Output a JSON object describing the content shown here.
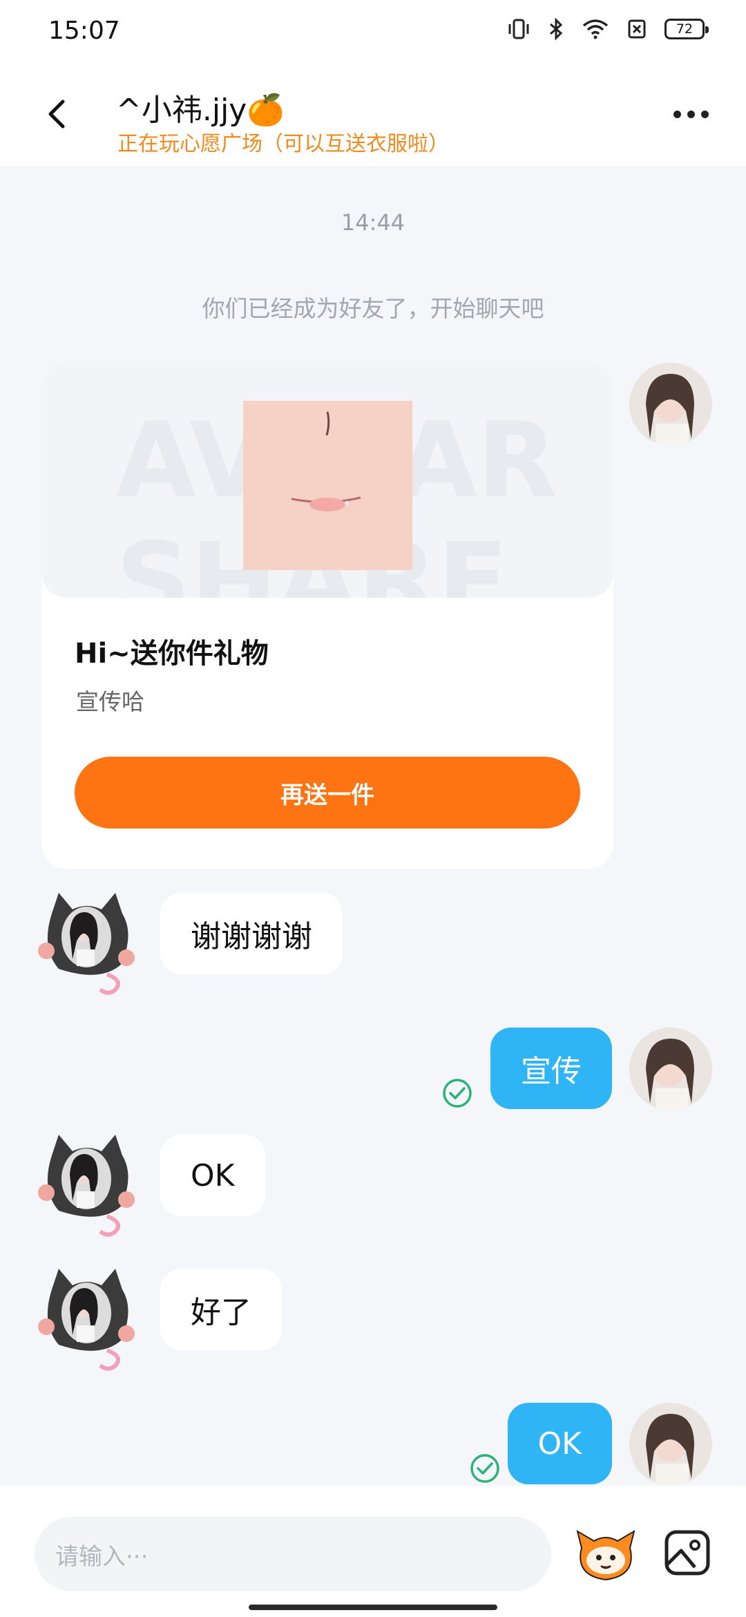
{
  "status_bar": {
    "time": "15:07",
    "battery": "72",
    "icons": [
      "vibrate-icon",
      "bluetooth-icon",
      "wifi-icon",
      "sim-off-icon",
      "battery-icon"
    ]
  },
  "header": {
    "title": "^小祎.jjy🍊",
    "subtitle": "正在玩心愿广场（可以互送衣服啦）",
    "back_icon": "back-arrow-icon",
    "more_icon": "more-dots-icon"
  },
  "chat": {
    "time_separator": "14:44",
    "system_note": "你们已经成为好友了，开始聊天吧",
    "gift_card": {
      "watermark": "AVATAR SHARE",
      "title": "Hi~送你件礼物",
      "subtitle": "宣传哈",
      "button_label": "再送一件"
    },
    "messages": [
      {
        "side": "in",
        "text": "谢谢谢谢"
      },
      {
        "side": "out",
        "text": "宣传",
        "read": true
      },
      {
        "side": "in",
        "text": "OK"
      },
      {
        "side": "in",
        "text": "好了"
      },
      {
        "side": "out",
        "text": "OK",
        "read": true
      }
    ]
  },
  "composer": {
    "placeholder": "请输入···",
    "mascot_icon": "mascot-icon",
    "image_icon": "image-icon"
  },
  "colors": {
    "accent_orange": "#ff7412",
    "bubble_blue": "#2fb5f5",
    "subtitle_orange": "#f08a1c",
    "read_green": "#2ab27b"
  }
}
